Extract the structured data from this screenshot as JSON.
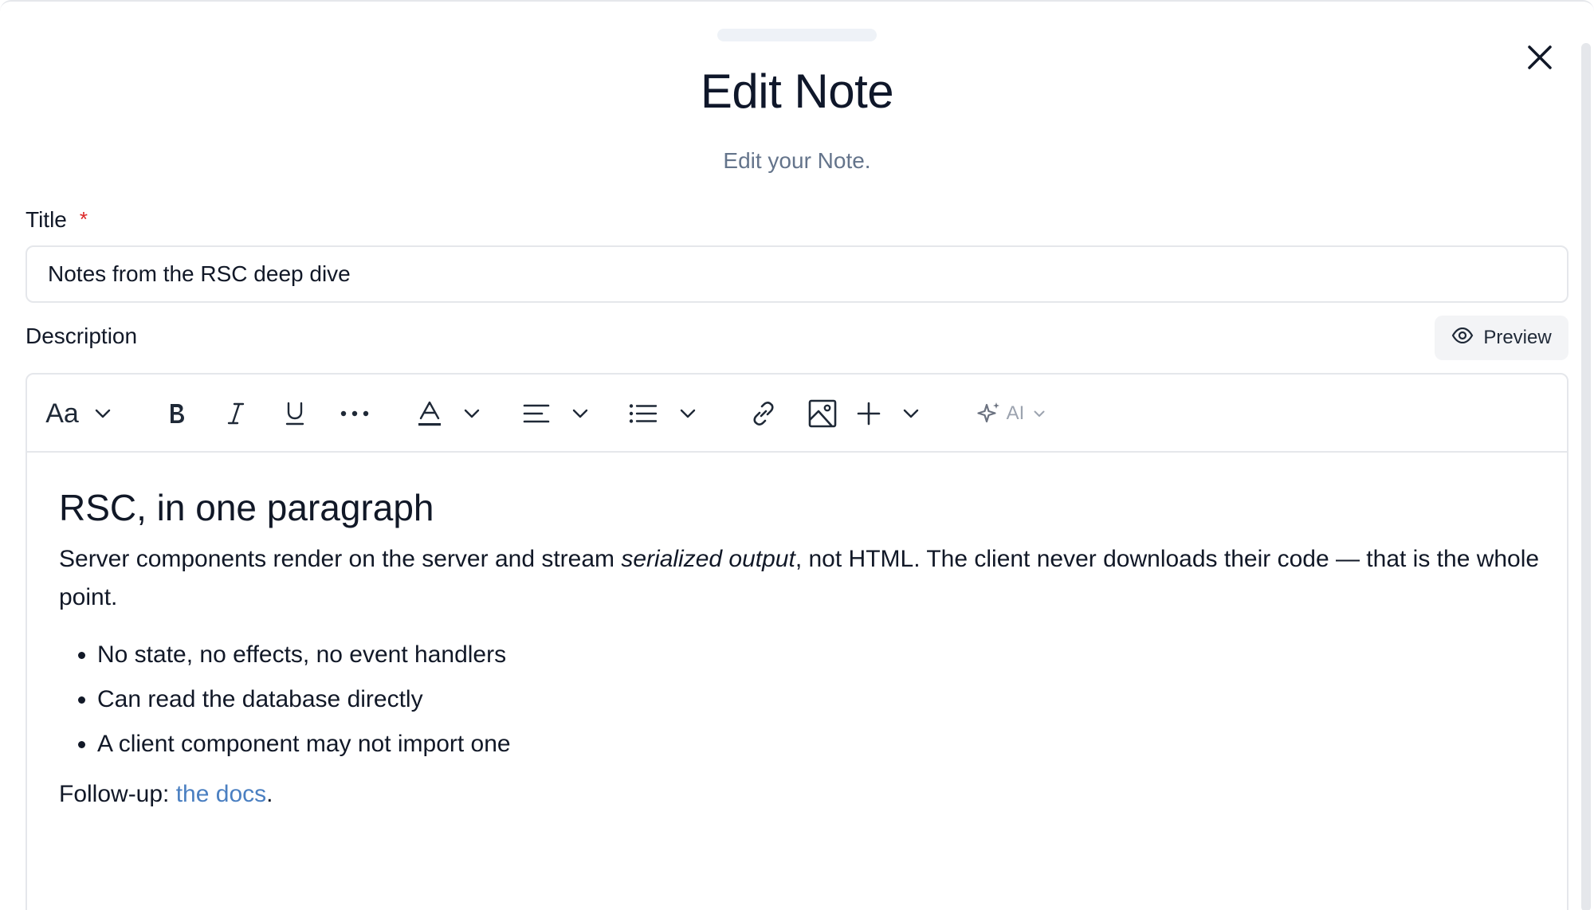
{
  "dialog": {
    "title": "Edit Note",
    "subtitle": "Edit your Note."
  },
  "form": {
    "title_label": "Title",
    "required_marker": "*",
    "title_value": "Notes from the RSC deep dive",
    "description_label": "Description",
    "preview_label": "Preview"
  },
  "toolbar": {
    "text_style_label": "Aa",
    "ai_label": "AI",
    "items": [
      "text-style",
      "bold",
      "italic",
      "underline",
      "more",
      "text-color",
      "align",
      "list",
      "link",
      "image",
      "insert",
      "ai"
    ]
  },
  "content": {
    "heading": "RSC, in one paragraph",
    "para_before": "Server components render on the server and stream ",
    "para_emphasis": "serialized output",
    "para_after": ", not HTML. The client never downloads their code — that is the whole point.",
    "bullets": [
      "No state, no effects, no event handlers",
      "Can read the database directly",
      "A client component may not import one"
    ],
    "followup_prefix": "Follow-up: ",
    "followup_link": "the docs",
    "followup_suffix": "."
  },
  "colors": {
    "required": "#dc2626",
    "link": "#4a7fc1",
    "subtitle": "#64748b",
    "border": "#e5e7eb"
  }
}
